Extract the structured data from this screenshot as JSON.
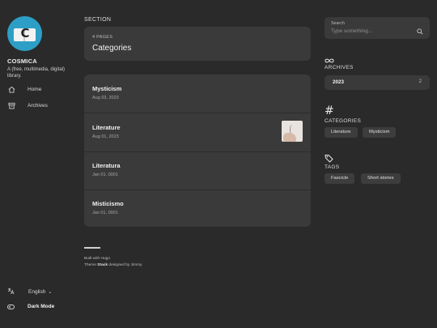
{
  "site": {
    "logo_letter": "C",
    "title": "COSMICA",
    "description": "A (free, multimedia, digital) library."
  },
  "menu": [
    {
      "label": "Home",
      "icon": "home-icon"
    },
    {
      "label": "Archives",
      "icon": "archive-icon"
    }
  ],
  "footer_controls": {
    "language": "English",
    "dark_mode": "Dark Mode"
  },
  "section": {
    "label": "SECTION",
    "count": "4 PAGES",
    "title": "Categories"
  },
  "posts": [
    {
      "title": "Mysticism",
      "date": "Aug 03, 2023",
      "has_thumb": false
    },
    {
      "title": "Literature",
      "date": "Aug 01, 2023",
      "has_thumb": true
    },
    {
      "title": "Literatura",
      "date": "Jan 01, 0001",
      "has_thumb": false
    },
    {
      "title": "Misticismo",
      "date": "Jan 01, 0001",
      "has_thumb": false
    }
  ],
  "footer": {
    "built": "Built with Hugo",
    "theme_prefix": "Theme ",
    "theme_name": "Stack",
    "theme_suffix": " designed by Jimmy"
  },
  "search": {
    "label": "Search",
    "placeholder": "Type something..."
  },
  "archives": {
    "title": "ARCHIVES",
    "year": "2023",
    "count": "2"
  },
  "categories": {
    "title": "CATEGORIES",
    "items": [
      "Literature",
      "Mysticism"
    ]
  },
  "tags": {
    "title": "TAGS",
    "items": [
      "Fascicle",
      "Short stories"
    ]
  },
  "colors": {
    "background": "#2a2a2a",
    "card": "#3a3a3a",
    "avatar": "#2d9fc6"
  }
}
